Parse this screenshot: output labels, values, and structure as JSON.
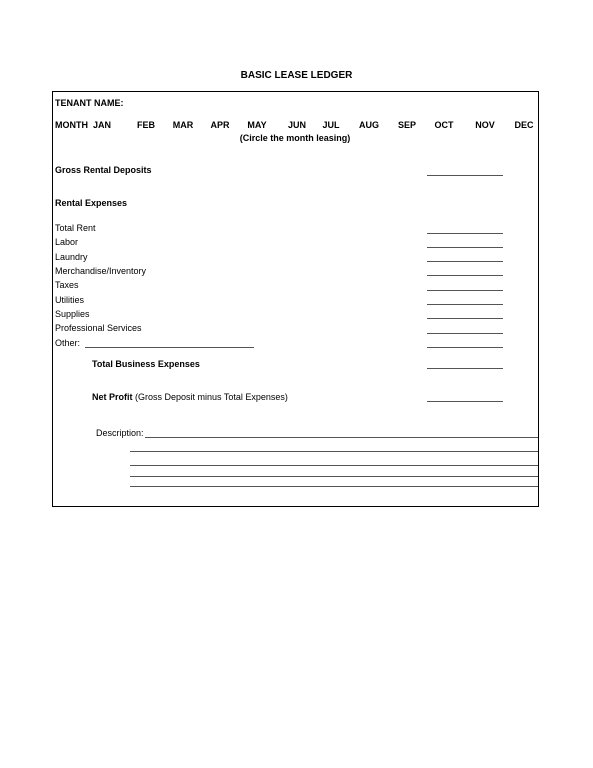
{
  "title": "BASIC LEASE LEDGER",
  "tenant_label": "TENANT NAME:",
  "month_label": "MONTH",
  "months": [
    "JAN",
    "FEB",
    "MAR",
    "APR",
    "MAY",
    "JUN",
    "JUL",
    "AUG",
    "SEP",
    "OCT",
    "NOV",
    "DEC"
  ],
  "month_note": "(Circle the month leasing)",
  "gross_rental_deposits": "Gross Rental Deposits",
  "rental_expenses_heading": "Rental Expenses",
  "expense_items": [
    "Total Rent",
    "Labor",
    "Laundry",
    "Merchandise/Inventory",
    "Taxes",
    "Utilities",
    "Supplies",
    "Professional Services",
    "Other:"
  ],
  "total_business_expenses": "Total Business Expenses",
  "net_profit_label": "Net Profit",
  "net_profit_note": "(Gross Deposit minus Total Expenses)",
  "description_label": "Description:"
}
